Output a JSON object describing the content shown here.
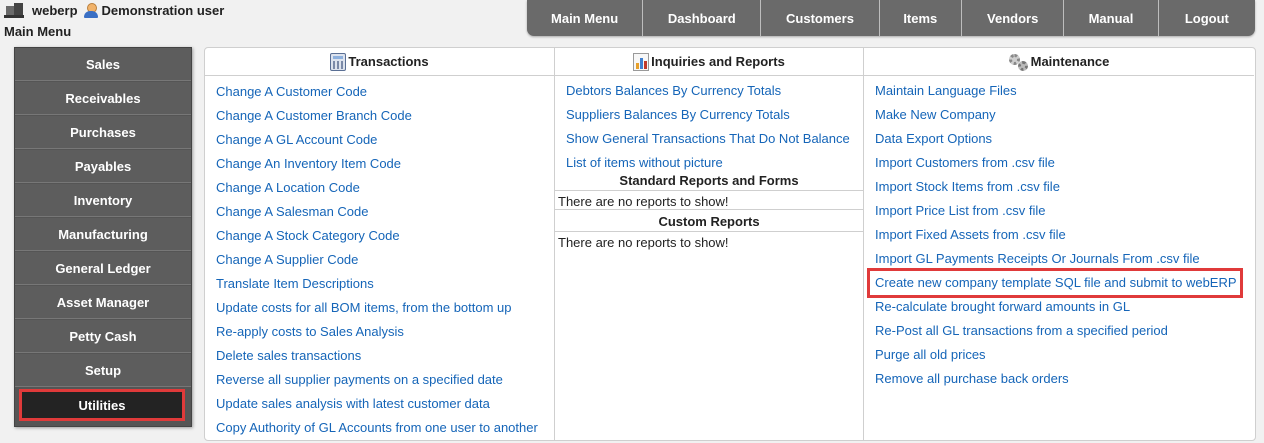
{
  "header": {
    "company": "weberp",
    "user": "Demonstration user",
    "page_title": "Main Menu"
  },
  "topnav": [
    "Main Menu",
    "Dashboard",
    "Customers",
    "Items",
    "Vendors",
    "Manual",
    "Logout"
  ],
  "sidebar": {
    "items": [
      "Sales",
      "Receivables",
      "Purchases",
      "Payables",
      "Inventory",
      "Manufacturing",
      "General Ledger",
      "Asset Manager",
      "Petty Cash",
      "Setup",
      "Utilities"
    ],
    "active": "Utilities"
  },
  "transactions": {
    "title": "Transactions",
    "links": [
      "Change A Customer Code",
      "Change A Customer Branch Code",
      "Change A GL Account Code",
      "Change An Inventory Item Code",
      "Change A Location Code",
      "Change A Salesman Code",
      "Change A Stock Category Code",
      "Change A Supplier Code",
      "Translate Item Descriptions",
      "Update costs for all BOM items, from the bottom up",
      "Re-apply costs to Sales Analysis",
      "Delete sales transactions",
      "Reverse all supplier payments on a specified date",
      "Update sales analysis with latest customer data",
      "Copy Authority of GL Accounts from one user to another"
    ]
  },
  "inquiries": {
    "title": "Inquiries and Reports",
    "links": [
      "Debtors Balances By Currency Totals",
      "Suppliers Balances By Currency Totals",
      "Show General Transactions That Do Not Balance",
      "List of items without picture"
    ],
    "standard_title": "Standard Reports and Forms",
    "standard_note": "There are no reports to show!",
    "custom_title": "Custom Reports",
    "custom_note": "There are no reports to show!"
  },
  "maintenance": {
    "title": "Maintenance",
    "links": [
      "Maintain Language Files",
      "Make New Company",
      "Data Export Options",
      "Import Customers from .csv file",
      "Import Stock Items from .csv file",
      "Import Price List from .csv file",
      "Import Fixed Assets from .csv file",
      "Import GL Payments Receipts Or Journals From .csv file",
      "Create new company template SQL file and submit to webERP",
      "Re-calculate brought forward amounts in GL",
      "Re-Post all GL transactions from a specified period",
      "Purge all old prices",
      "Remove all purchase back orders"
    ],
    "highlighted_index": 8
  },
  "colors": {
    "link": "#1565b8",
    "nav_bg": "#6a6a6a",
    "active_menu": "#232323",
    "highlight": "#e03a3a"
  }
}
